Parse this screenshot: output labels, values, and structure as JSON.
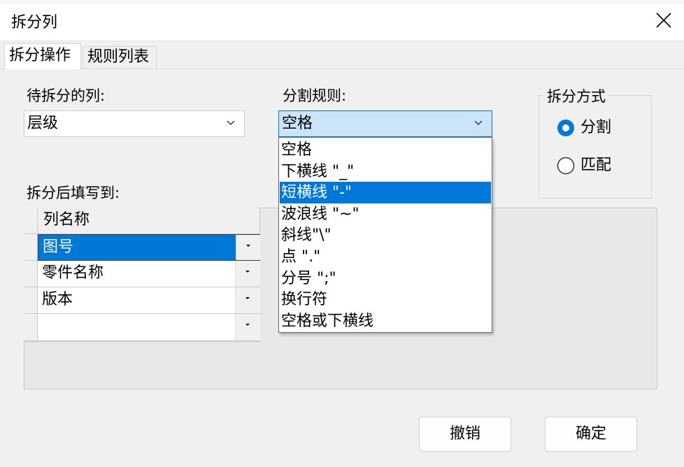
{
  "window": {
    "title": "拆分列"
  },
  "tabs": [
    {
      "label": "拆分操作",
      "active": true
    },
    {
      "label": "规则列表",
      "active": false
    }
  ],
  "source_column": {
    "label": "待拆分的列:",
    "value": "层级"
  },
  "split_rule": {
    "label": "分割规则:",
    "value": "空格",
    "options": [
      "空格",
      "下横线 \"_\"",
      "短横线 \"-\"",
      "波浪线 \"~\"",
      "斜线\"\\\"",
      "点 \".\"",
      "分号 \";\"",
      "换行符",
      "空格或下横线"
    ],
    "highlighted_option": "短横线 \"-\""
  },
  "split_mode": {
    "title": "拆分方式",
    "options": [
      {
        "label": "分割",
        "checked": true
      },
      {
        "label": "匹配",
        "checked": false
      }
    ]
  },
  "target": {
    "label": "拆分后填写到:",
    "column_header": "列名称",
    "rows": [
      "图号",
      "零件名称",
      "版本",
      ""
    ],
    "selected_row": "图号"
  },
  "buttons": {
    "cancel": "撤销",
    "ok": "确定"
  },
  "colors": {
    "accent": "#0078d7",
    "combo_focus": "#cce4f7",
    "background": "#f0f0f0"
  }
}
